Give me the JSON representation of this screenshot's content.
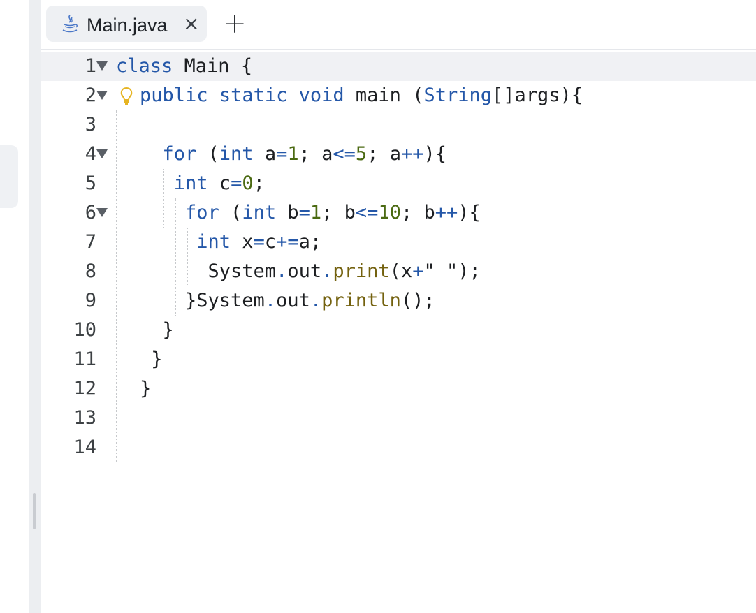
{
  "tab": {
    "file_name": "Main.java",
    "close_glyph": "×",
    "icon": "java-icon"
  },
  "new_tab_glyph": "+",
  "editor": {
    "active_line": 1,
    "lines": [
      {
        "num": "1",
        "fold": true
      },
      {
        "num": "2",
        "fold": true,
        "bulb": true
      },
      {
        "num": "3"
      },
      {
        "num": "4",
        "fold": true
      },
      {
        "num": "5"
      },
      {
        "num": "6",
        "fold": true
      },
      {
        "num": "7"
      },
      {
        "num": "8"
      },
      {
        "num": "9"
      },
      {
        "num": "10"
      },
      {
        "num": "11"
      },
      {
        "num": "12"
      },
      {
        "num": "13"
      },
      {
        "num": "14"
      }
    ],
    "tokens": {
      "l1": [
        "class",
        " Main {"
      ],
      "l2": [
        "public",
        " ",
        "static",
        " ",
        "void",
        " main (",
        "String",
        "[]args){"
      ],
      "l4": [
        "  for",
        " (",
        "int",
        " a",
        "=",
        "1",
        "; a",
        "<=",
        "5",
        "; a",
        "++",
        "){"
      ],
      "l5": [
        "   int",
        " c",
        "=",
        "0",
        ";"
      ],
      "l6": [
        "    for",
        " (",
        "int",
        " b",
        "=",
        "1",
        "; b",
        "<=",
        "10",
        "; b",
        "++",
        "){"
      ],
      "l7": [
        "     int",
        " x",
        "=",
        "c",
        "+=",
        "a;"
      ],
      "l8": [
        "      System",
        ".",
        "out",
        ".",
        "print",
        "(x",
        "+",
        "\" \"",
        ");"
      ],
      "l9": [
        "    }System",
        ".",
        "out",
        ".",
        "println",
        "();"
      ],
      "l10": [
        "  }"
      ],
      "l11": [
        " }"
      ],
      "l12": [
        "}"
      ]
    }
  },
  "colors": {
    "keyword": "#2457a8",
    "number": "#4b6a12",
    "method": "#73610e",
    "text": "#1d1f22"
  }
}
